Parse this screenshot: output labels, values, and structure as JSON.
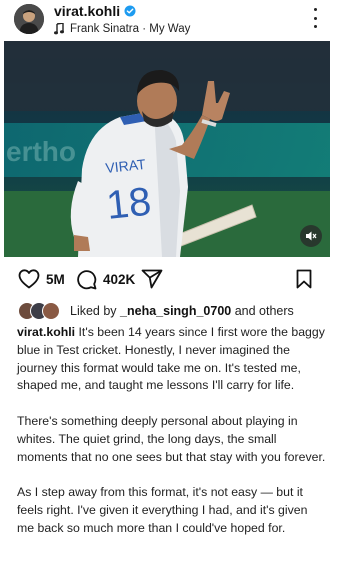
{
  "header": {
    "username": "virat.kohli",
    "audio": "Frank Sinatra · My Way"
  },
  "actions": {
    "likes": "5M",
    "comments": "402K"
  },
  "liked_by": {
    "prefix": "Liked by",
    "user": "_neha_singh_0700",
    "suffix": "and others"
  },
  "caption": {
    "username": "virat.kohli",
    "p1": "It's been 14 years since I first wore the baggy blue in Test cricket. Honestly, I never imagined the journey this format would take me on. It's tested me, shaped me, and taught me lessons I'll carry for life.",
    "p2": "There's something deeply personal about playing in whites. The quiet grind, the long days, the small moments that no one sees but that stay with you forever.",
    "p3": "As I step away from this format, it's not easy — but it feels right. I've given it everything I had, and it's given me back so much more than I could've hoped for."
  },
  "photo": {
    "jersey_name": "VIRAT",
    "jersey_number": "18"
  },
  "colors": {
    "verified": "#1d9bf0",
    "jersey": "#f2f3f5",
    "jersey_blue": "#2f5fb3"
  },
  "icons": {
    "verified": "verified-badge-icon",
    "music": "music-note-icon",
    "more": "more-vertical-icon",
    "mute": "mute-icon",
    "like": "heart-icon",
    "comment": "comment-icon",
    "share": "send-icon",
    "save": "bookmark-icon"
  }
}
